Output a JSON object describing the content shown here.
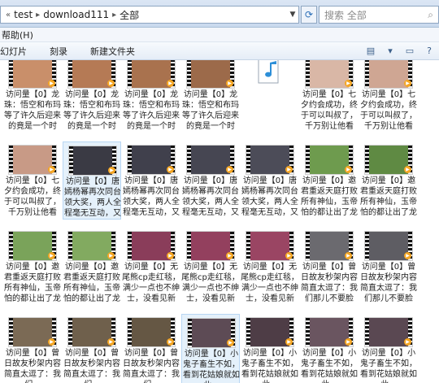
{
  "address": {
    "segments": [
      "test",
      "download111",
      "全部"
    ],
    "search_placeholder": "搜索 全部"
  },
  "menu": {
    "help": "帮助(H)"
  },
  "toolbar": {
    "slideshow": "幻灯片",
    "burn": "刻录",
    "new_folder": "新建文件夹"
  },
  "colors": {
    "selection": "#e5f1fb",
    "play_badge": "#f5a623",
    "accent": "#2b6fb7"
  },
  "files": [
    {
      "label": "访问量【0】龙珠：悟空和布玛等了许久后迎来的竟是一个时毫...",
      "thumb": "#c98f6a",
      "kind": "video"
    },
    {
      "label": "访问量【0】龙珠：悟空和布玛等了许久后迎来的竟是一个时毫...",
      "thumb": "#b57a55",
      "kind": "video"
    },
    {
      "label": "访问量【0】龙珠：悟空和布玛等了许久后迎来的竟是一个时毫...",
      "thumb": "#a9724e",
      "kind": "video"
    },
    {
      "label": "访问量【0】龙珠：悟空和布玛等了许久后迎来的竟是一个时毫...",
      "thumb": "#9c6a4a",
      "kind": "video"
    },
    {
      "label": "",
      "thumb": "#ffffff",
      "kind": "audio"
    },
    {
      "label": "访问量【0】七夕约会成功，终于可以叫叔了，千万别让他看到！...",
      "thumb": "#d9b7a6",
      "kind": "video"
    },
    {
      "label": "访问量【0】七夕约会成功，终于可以叫叔了，千万别让他看到！...",
      "thumb": "#cfa693",
      "kind": "video"
    },
    {
      "label": "访问量【0】七夕约会成功，终于可以叫叔了，千万别让他看到！...",
      "thumb": "#c89a86",
      "kind": "video"
    },
    {
      "label": "访问量【0】唐嫣杨幂再次同台领大奖，两人全程毫无互动，又妙...",
      "thumb": "#3a3a44",
      "kind": "video"
    },
    {
      "label": "访问量【0】唐嫣杨幂再次同台领大奖，两人全程毫无互动，又妙...",
      "thumb": "#40404c",
      "kind": "video"
    },
    {
      "label": "访问量【0】唐嫣杨幂再次同台领大奖，两人全程毫无互动，又妙...",
      "thumb": "#464652",
      "kind": "video"
    },
    {
      "label": "访问量【0】唐嫣杨幂再次同台领大奖，两人全程毫无互动，又妙...",
      "thumb": "#4c4c58",
      "kind": "video"
    },
    {
      "label": "访问量【0】邀君重返天庭打败所有神仙，玉帝怕的都让出了龙座...",
      "thumb": "#6e9b4e",
      "kind": "video"
    },
    {
      "label": "访问量【0】邀君重返天庭打败所有神仙，玉帝怕的都让出了龙座...",
      "thumb": "#5f8a43",
      "kind": "video"
    },
    {
      "label": "访问量【0】邀君重返天庭打败所有神仙，玉帝怕的都让出了龙座...",
      "thumb": "#7aa35a",
      "kind": "video"
    },
    {
      "label": "访问量【0】邀君重返天庭打败所有神仙，玉帝怕的都让出了龙座...",
      "thumb": "#82aa60",
      "kind": "video"
    },
    {
      "label": "访问量【0】无尾熊cp走红毯，满少一点也不绅士，没看见新娘...",
      "thumb": "#8a3d5a",
      "kind": "video"
    },
    {
      "label": "访问量【0】无尾熊cp走红毯，满少一点也不绅士，没看见新娘...",
      "thumb": "#93405e",
      "kind": "video"
    },
    {
      "label": "访问量【0】无尾熊cp走红毯，满少一点也不绅士，没看见新娘...",
      "thumb": "#9a4563",
      "kind": "video"
    },
    {
      "label": "访问量【0】曾日故友秒架内容简直太逗了：我们那儿不要脸了...",
      "thumb": "#6b6a6f",
      "kind": "video"
    },
    {
      "label": "访问量【0】曾日故友秒架内容简直太逗了：我们那儿不要脸了...",
      "thumb": "#5e5d63",
      "kind": "video"
    },
    {
      "label": "访问量【0】曾日故友秒架内容简直太逗了：我们...",
      "thumb": "#7b6a55",
      "kind": "video"
    },
    {
      "label": "访问量【0】曾日故友秒架内容简直太逗了：我们...",
      "thumb": "#6f604c",
      "kind": "video"
    },
    {
      "label": "访问量【0】曾日故友秒架内容简直太逗了：我们...",
      "thumb": "#655744",
      "kind": "video"
    },
    {
      "label": "访问量【0】小鬼子畜生不如，看到花姑娘就如此...",
      "thumb": "#5d4b55",
      "kind": "video"
    },
    {
      "label": "访问量【0】小鬼子畜生不如，看到花姑娘就如此...",
      "thumb": "#4e3d46",
      "kind": "video"
    },
    {
      "label": "访问量【0】小鬼子畜生不如，看到花姑娘就如此...",
      "thumb": "#6a5560",
      "kind": "video"
    },
    {
      "label": "访问量【0】小鬼子畜生不如，看到花姑娘就如此...",
      "thumb": "#5a4852",
      "kind": "video"
    }
  ]
}
